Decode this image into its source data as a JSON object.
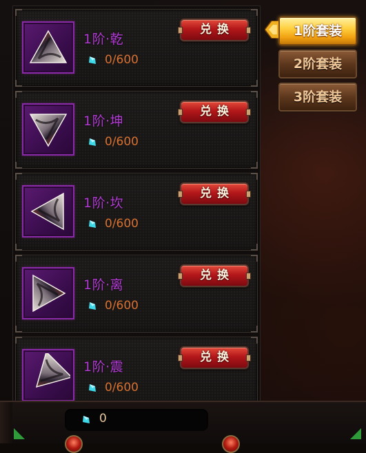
{
  "tabs": [
    {
      "label": "1阶套装",
      "active": true
    },
    {
      "label": "2阶套装",
      "active": false
    },
    {
      "label": "3阶套装",
      "active": false
    }
  ],
  "items": [
    {
      "name": "1阶·乾",
      "progress": "0/600",
      "exchange_label": "兑换"
    },
    {
      "name": "1阶·坤",
      "progress": "0/600",
      "exchange_label": "兑换"
    },
    {
      "name": "1阶·坎",
      "progress": "0/600",
      "exchange_label": "兑换"
    },
    {
      "name": "1阶·离",
      "progress": "0/600",
      "exchange_label": "兑换"
    },
    {
      "name": "1阶·震",
      "progress": "0/600",
      "exchange_label": "兑换"
    }
  ],
  "currency": {
    "icon": "crystal-icon",
    "value": "0"
  },
  "colors": {
    "item_name": "#b23ad4",
    "progress": "#d77030",
    "exchange_button": "#b3171a",
    "active_tab": "#ffd040",
    "inactive_tab": "#5d371d",
    "gem": "#3fd8e8"
  }
}
